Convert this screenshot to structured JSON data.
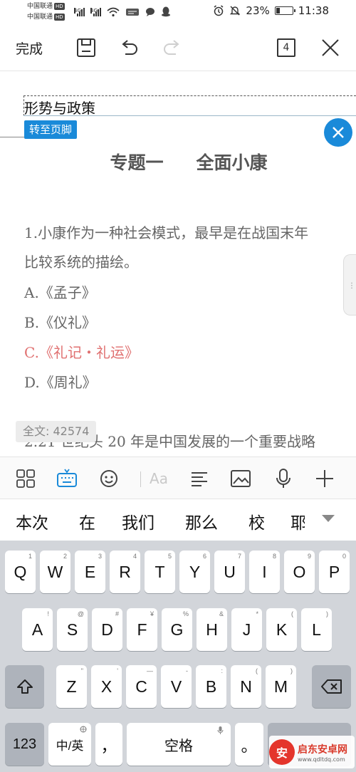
{
  "status": {
    "carrier1": "中国联通",
    "carrier2": "中国联通",
    "hd": "HD",
    "net1": "4G",
    "net2": "4G",
    "battery_pct": "23%",
    "battery_level": 0.23,
    "time": "11:38"
  },
  "toolbar": {
    "done_label": "完成",
    "tab_count": "4"
  },
  "document": {
    "header_text": "形势与政策",
    "to_footer_label": "转至页脚",
    "title_part1": "专题一",
    "title_part2": "全面小康",
    "q1_line1": "1.小康作为一种社会模式，最早是在战国末年",
    "q1_line2": "比较系统的描绘。",
    "options": [
      "A.《孟子》",
      "B.《仪礼》",
      "C.《礼记・礼运》",
      "D.《周礼》"
    ],
    "q2_line1": "2.21 世纪头 20 年是中国发展的一个重要战略",
    "word_count": "全文: 42574",
    "selected_option_color": "#e07070"
  },
  "edit_toolbar": {
    "font_label": "Aa"
  },
  "candidates": [
    "本次",
    "在",
    "我们",
    "那么",
    "校",
    "耶"
  ],
  "keyboard": {
    "row1": [
      {
        "key": "Q",
        "sub": "1"
      },
      {
        "key": "W",
        "sub": "2"
      },
      {
        "key": "E",
        "sub": "3"
      },
      {
        "key": "R",
        "sub": "4"
      },
      {
        "key": "T",
        "sub": "5"
      },
      {
        "key": "Y",
        "sub": "6"
      },
      {
        "key": "U",
        "sub": "7"
      },
      {
        "key": "I",
        "sub": "8"
      },
      {
        "key": "O",
        "sub": "9"
      },
      {
        "key": "P",
        "sub": "0"
      }
    ],
    "row2": [
      {
        "key": "A",
        "sub": "!"
      },
      {
        "key": "S",
        "sub": "@"
      },
      {
        "key": "D",
        "sub": "#"
      },
      {
        "key": "F",
        "sub": "¥"
      },
      {
        "key": "G",
        "sub": "%"
      },
      {
        "key": "H",
        "sub": "&"
      },
      {
        "key": "J",
        "sub": "*"
      },
      {
        "key": "K",
        "sub": "("
      },
      {
        "key": "L",
        "sub": ")"
      }
    ],
    "row3": [
      {
        "key": "Z",
        "sub": "\""
      },
      {
        "key": "X",
        "sub": "'"
      },
      {
        "key": "C",
        "sub": "—"
      },
      {
        "key": "V",
        "sub": "-"
      },
      {
        "key": "B",
        "sub": ":"
      },
      {
        "key": "N",
        "sub": "("
      },
      {
        "key": "M",
        "sub": ")"
      }
    ],
    "num_label": "123",
    "lang_label": "中/英",
    "comma_label": "，",
    "space_label": "空格",
    "period_label": "。"
  },
  "watermark": {
    "name": "启东安卓网",
    "url": "www.qdltdq.com"
  },
  "colors": {
    "accent": "#1a8ad9",
    "selected_option": "#e07070"
  }
}
